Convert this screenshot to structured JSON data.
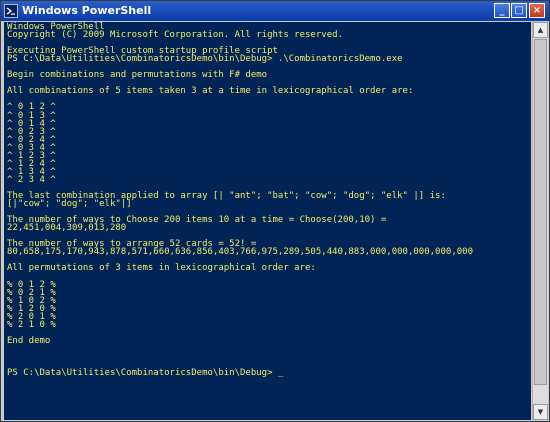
{
  "window": {
    "title": "Windows PowerShell",
    "minimize_glyph": "_",
    "maximize_glyph": "□",
    "close_glyph": "×"
  },
  "colors": {
    "console_background": "#012456",
    "console_text": "#eeed6a",
    "titlebar": "#0a3aa8"
  },
  "console": {
    "lines": [
      "Windows PowerShell",
      "Copyright (C) 2009 Microsoft Corporation. All rights reserved.",
      "",
      "Executing PowerShell custom startup profile script",
      "PS C:\\Data\\Utilities\\CombinatoricsDemo\\bin\\Debug> .\\CombinatoricsDemo.exe",
      "",
      "Begin combinations and permutations with F# demo",
      "",
      "All combinations of 5 items taken 3 at a time in lexicographical order are:",
      "",
      "^ 0 1 2 ^",
      "^ 0 1 3 ^",
      "^ 0 1 4 ^",
      "^ 0 2 3 ^",
      "^ 0 2 4 ^",
      "^ 0 3 4 ^",
      "^ 1 2 3 ^",
      "^ 1 2 4 ^",
      "^ 1 3 4 ^",
      "^ 2 3 4 ^",
      "",
      "The last combination applied to array [| \"ant\"; \"bat\"; \"cow\"; \"dog\"; \"elk\" |] is:",
      "[|\"cow\"; \"dog\"; \"elk\"|]",
      "",
      "The number of ways to Choose 200 items 10 at a time = Choose(200,10) =",
      "22,451,004,309,013,280",
      "",
      "The number of ways to arrange 52 cards = 52! =",
      "80,658,175,170,943,878,571,660,636,856,403,766,975,289,505,440,883,000,000,000,000,000",
      "",
      "All permutations of 3 items in lexicographical order are:",
      "",
      "% 0 1 2 %",
      "% 0 2 1 %",
      "% 1 0 2 %",
      "% 1 2 0 %",
      "% 2 0 1 %",
      "% 2 1 0 %",
      "",
      "End demo",
      "",
      "",
      "",
      "PS C:\\Data\\Utilities\\CombinatoricsDemo\\bin\\Debug> "
    ],
    "cursor": "_"
  },
  "scrollbar": {
    "up_glyph": "▲",
    "down_glyph": "▼"
  }
}
